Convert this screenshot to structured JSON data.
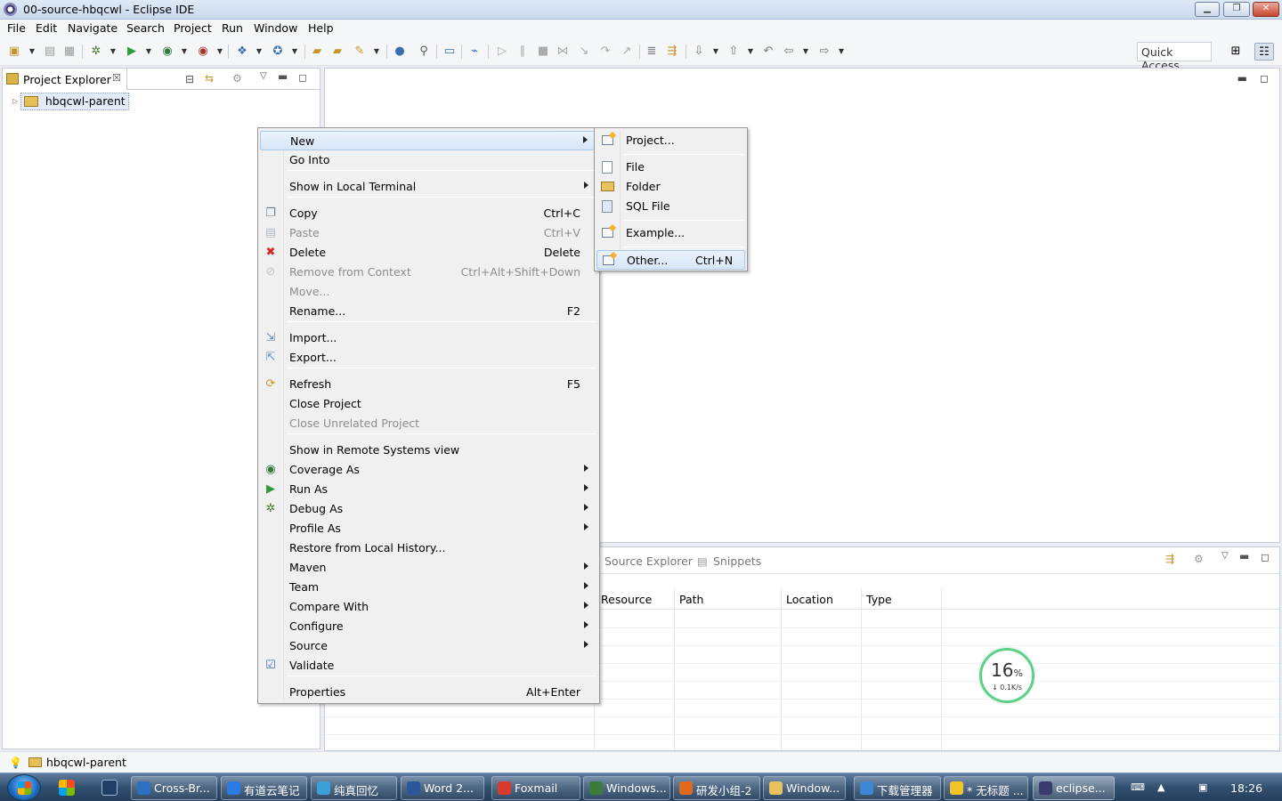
{
  "window": {
    "title": "00-source-hbqcwl - Eclipse IDE"
  },
  "menubar": [
    "File",
    "Edit",
    "Navigate",
    "Search",
    "Project",
    "Run",
    "Window",
    "Help"
  ],
  "toolbar": {
    "quick_access": "Quick Access"
  },
  "project_explorer": {
    "tab_label": "Project Explorer",
    "tab_close": "☒",
    "tree_item": "hbqcwl-parent"
  },
  "context_menu": {
    "items": [
      {
        "label": "New",
        "shortcut": "",
        "submenu": true,
        "icon": "none",
        "disabled": false,
        "highlight": true
      },
      {
        "label": "Go Into",
        "shortcut": "",
        "submenu": false,
        "icon": "none",
        "disabled": false
      },
      {
        "label": "Show in Local Terminal",
        "shortcut": "",
        "submenu": true,
        "icon": "none",
        "disabled": false
      },
      {
        "label": "Copy",
        "shortcut": "Ctrl+C",
        "submenu": false,
        "icon": "copy-icon",
        "disabled": false
      },
      {
        "label": "Paste",
        "shortcut": "Ctrl+V",
        "submenu": false,
        "icon": "paste-icon",
        "disabled": true
      },
      {
        "label": "Delete",
        "shortcut": "Delete",
        "submenu": false,
        "icon": "delete-icon",
        "disabled": false
      },
      {
        "label": "Remove from Context",
        "shortcut": "Ctrl+Alt+Shift+Down",
        "submenu": false,
        "icon": "remove-context-icon",
        "disabled": true
      },
      {
        "label": "Move...",
        "shortcut": "",
        "submenu": false,
        "icon": "none",
        "disabled": true
      },
      {
        "label": "Rename...",
        "shortcut": "F2",
        "submenu": false,
        "icon": "none",
        "disabled": false
      },
      {
        "label": "Import...",
        "shortcut": "",
        "submenu": false,
        "icon": "import-icon",
        "disabled": false
      },
      {
        "label": "Export...",
        "shortcut": "",
        "submenu": false,
        "icon": "export-icon",
        "disabled": false
      },
      {
        "label": "Refresh",
        "shortcut": "F5",
        "submenu": false,
        "icon": "refresh-icon",
        "disabled": false
      },
      {
        "label": "Close Project",
        "shortcut": "",
        "submenu": false,
        "icon": "none",
        "disabled": false
      },
      {
        "label": "Close Unrelated Project",
        "shortcut": "",
        "submenu": false,
        "icon": "none",
        "disabled": true
      },
      {
        "label": "Show in Remote Systems view",
        "shortcut": "",
        "submenu": false,
        "icon": "none",
        "disabled": false
      },
      {
        "label": "Coverage As",
        "shortcut": "",
        "submenu": true,
        "icon": "coverage-icon",
        "disabled": false
      },
      {
        "label": "Run As",
        "shortcut": "",
        "submenu": true,
        "icon": "run-icon",
        "disabled": false
      },
      {
        "label": "Debug As",
        "shortcut": "",
        "submenu": true,
        "icon": "debug-icon",
        "disabled": false
      },
      {
        "label": "Profile As",
        "shortcut": "",
        "submenu": true,
        "icon": "none",
        "disabled": false
      },
      {
        "label": "Restore from Local History...",
        "shortcut": "",
        "submenu": false,
        "icon": "none",
        "disabled": false
      },
      {
        "label": "Maven",
        "shortcut": "",
        "submenu": true,
        "icon": "none",
        "disabled": false
      },
      {
        "label": "Team",
        "shortcut": "",
        "submenu": true,
        "icon": "none",
        "disabled": false
      },
      {
        "label": "Compare With",
        "shortcut": "",
        "submenu": true,
        "icon": "none",
        "disabled": false
      },
      {
        "label": "Configure",
        "shortcut": "",
        "submenu": true,
        "icon": "none",
        "disabled": false
      },
      {
        "label": "Source",
        "shortcut": "",
        "submenu": true,
        "icon": "none",
        "disabled": false
      },
      {
        "label": "Validate",
        "shortcut": "",
        "submenu": false,
        "icon": "checkbox-checked-icon",
        "disabled": false
      },
      {
        "label": "Properties",
        "shortcut": "Alt+Enter",
        "submenu": false,
        "icon": "none",
        "disabled": false
      }
    ]
  },
  "new_submenu": {
    "items": [
      {
        "label": "Project...",
        "shortcut": "",
        "icon": "new-project-wizard-icon"
      },
      {
        "label": "File",
        "shortcut": "",
        "icon": "new-file-icon"
      },
      {
        "label": "Folder",
        "shortcut": "",
        "icon": "folder-icon"
      },
      {
        "label": "SQL File",
        "shortcut": "",
        "icon": "sql-file-icon"
      },
      {
        "label": "Example...",
        "shortcut": "",
        "icon": "example-wizard-icon"
      },
      {
        "label": "Other...",
        "shortcut": "Ctrl+N",
        "icon": "other-wizard-icon",
        "highlight": true
      }
    ]
  },
  "bottom_panel": {
    "tabs": [
      "Source Explorer",
      "Snippets"
    ],
    "columns": [
      "Resource",
      "Path",
      "Location",
      "Type"
    ]
  },
  "net_monitor": {
    "percent": "16",
    "percent_sign": "%",
    "speed": "0.1K/s"
  },
  "statusbar": {
    "selected": "hbqcwl-parent"
  },
  "taskbar": {
    "tasks": [
      {
        "label": "Cross-Br...",
        "color": "#2f6fc1"
      },
      {
        "label": "有道云笔记",
        "color": "#2a7be4"
      },
      {
        "label": "纯真回忆",
        "color": "#3aa0d8"
      },
      {
        "label": "Word 2...",
        "color": "#2b579a"
      },
      {
        "label": "Foxmail",
        "color": "#d83b2c"
      },
      {
        "label": "Windows...",
        "color": "#3b7b3b"
      },
      {
        "label": "研发小组-2",
        "color": "#e06a1c"
      },
      {
        "label": "Window...",
        "color": "#e7c25e"
      },
      {
        "label": "下载管理器",
        "color": "#3e86d6"
      },
      {
        "label": "* 无标题 ...",
        "color": "#f2c32b"
      },
      {
        "label": "eclipse...",
        "color": "#3b3a6e"
      }
    ],
    "clock": "18:26"
  }
}
